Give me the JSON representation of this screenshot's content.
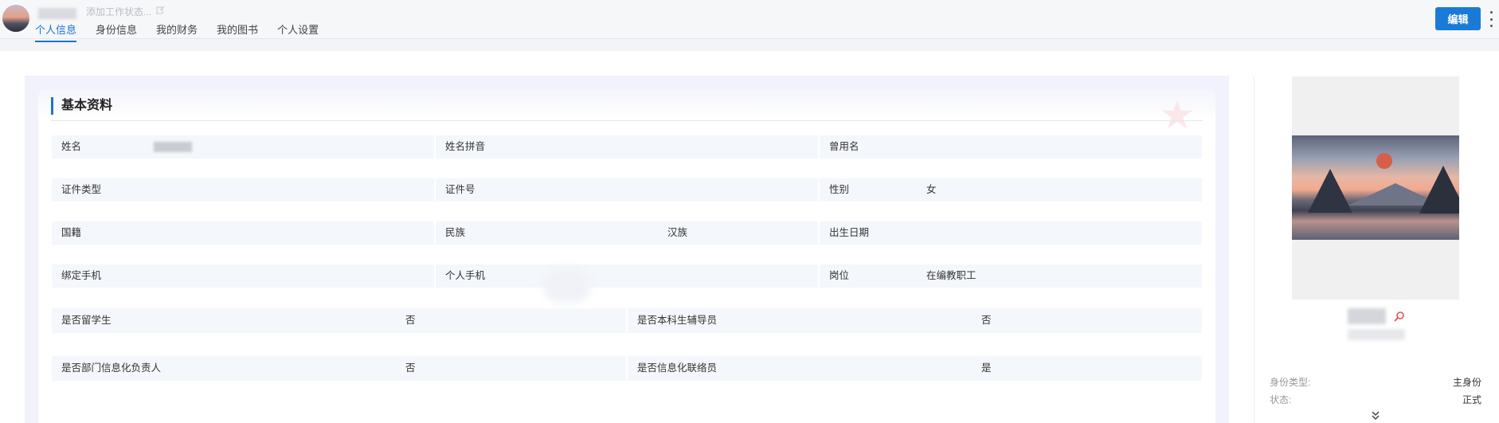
{
  "header": {
    "status_placeholder": "添加工作状态...",
    "tabs": [
      "个人信息",
      "身份信息",
      "我的财务",
      "我的图书",
      "个人设置"
    ],
    "active_tab": 0,
    "edit_label": "编辑"
  },
  "section": {
    "title": "基本资料",
    "rows": [
      [
        {
          "label": "姓名",
          "value": ""
        },
        {
          "label": "姓名拼音",
          "value": ""
        },
        {
          "label": "曾用名",
          "value": ""
        }
      ],
      [
        {
          "label": "证件类型",
          "value": ""
        },
        {
          "label": "证件号",
          "value": ""
        },
        {
          "label": "性别",
          "value": "女"
        }
      ],
      [
        {
          "label": "国籍",
          "value": ""
        },
        {
          "label": "民族",
          "value": "汉族"
        },
        {
          "label": "出生日期",
          "value": ""
        }
      ],
      [
        {
          "label": "绑定手机",
          "value": ""
        },
        {
          "label": "个人手机",
          "value": ""
        },
        {
          "label": "岗位",
          "value": "在编教职工"
        }
      ],
      [
        {
          "label": "是否留学生",
          "value": "否"
        },
        {
          "label": "是否本科生辅导员",
          "value": "否"
        }
      ],
      [
        {
          "label": "是否部门信息化负责人",
          "value": "否"
        },
        {
          "label": "是否信息化联络员",
          "value": "是"
        }
      ]
    ]
  },
  "side": {
    "identity_type_label": "身份类型:",
    "identity_type_value": "主身份",
    "status_label": "状态:",
    "status_value": "正式"
  },
  "colors": {
    "accent": "#1876d1",
    "button": "#1a7bd6",
    "cell_bg": "#f4f7fc"
  }
}
